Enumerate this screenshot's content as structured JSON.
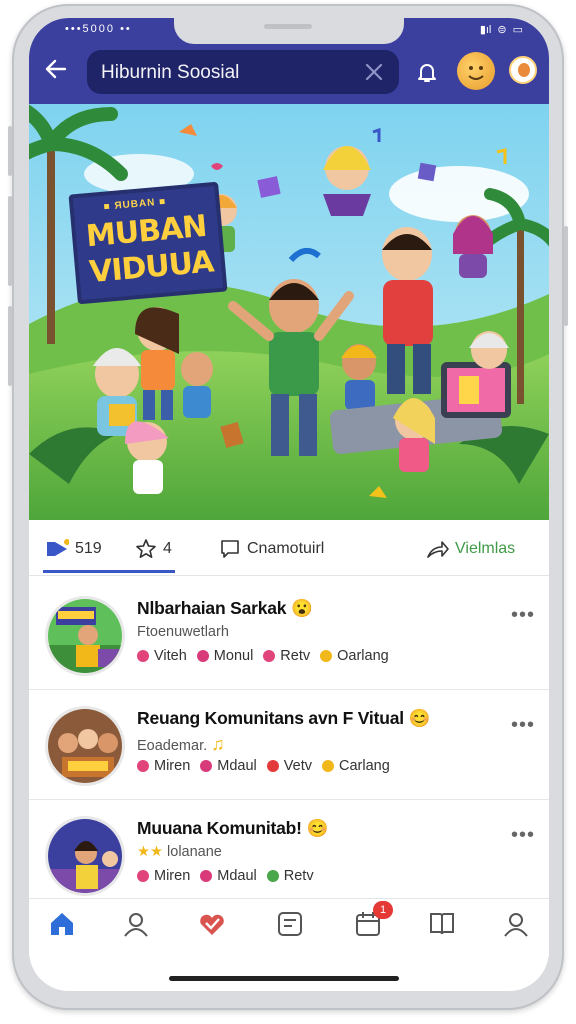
{
  "status_bar": {
    "left": "•••5000 ••",
    "right_signal": "▮ıl",
    "right_wifi": "⊜",
    "right_battery": "▭"
  },
  "header": {
    "search_text": "Hiburnin Soosial",
    "icons": [
      "back-arrow-icon",
      "close-icon",
      "bell-icon",
      "emoji-icon",
      "avatar-icon"
    ]
  },
  "hero": {
    "sign_top": "■ ЯUBAN ■",
    "sign_line1": "MUBAN",
    "sign_line2": "VIDUUA"
  },
  "stats": {
    "likes": "519",
    "shares": "4",
    "comments_label": "Cnamotuirl",
    "share_label": "Vielmlas",
    "colors": {
      "primary": "#3a57c8",
      "green": "#3f9a47"
    }
  },
  "feed": [
    {
      "title": "Nlbarhaian Sarkak",
      "emoji": "😮",
      "subtitle": "Ftoenuwetlarh",
      "tags": [
        {
          "label": "Viteh",
          "color": "#e0447a"
        },
        {
          "label": "Monul",
          "color": "#d93a7a"
        },
        {
          "label": "Retv",
          "color": "#e0447a"
        },
        {
          "label": "Oarlang",
          "color": "#f2b81a"
        }
      ]
    },
    {
      "title": "Reuang Komunitans avn F Vitual",
      "emoji": "😊",
      "subtitle": "Eoademar.",
      "music": "♫",
      "tags": [
        {
          "label": "Miren",
          "color": "#e0447a"
        },
        {
          "label": "Mdaul",
          "color": "#d93a7a"
        },
        {
          "label": "Vetv",
          "color": "#e23a3a"
        },
        {
          "label": "Carlang",
          "color": "#f2b81a"
        }
      ]
    },
    {
      "title": "Muuana Komunitab!",
      "emoji": "😊",
      "subtitle": "lolanane",
      "subtitle_icon": "★★",
      "tags": [
        {
          "label": "Miren",
          "color": "#e0447a"
        },
        {
          "label": "Mdaul",
          "color": "#d93a7a"
        },
        {
          "label": "Retv",
          "color": "#4aa64a"
        }
      ]
    }
  ],
  "tabbar": {
    "items": [
      "home-icon",
      "profile-icon",
      "heart-check-icon",
      "chat-square-icon",
      "calendar-icon",
      "book-icon",
      "account-icon"
    ],
    "badge": "1"
  },
  "more_label": "•••"
}
